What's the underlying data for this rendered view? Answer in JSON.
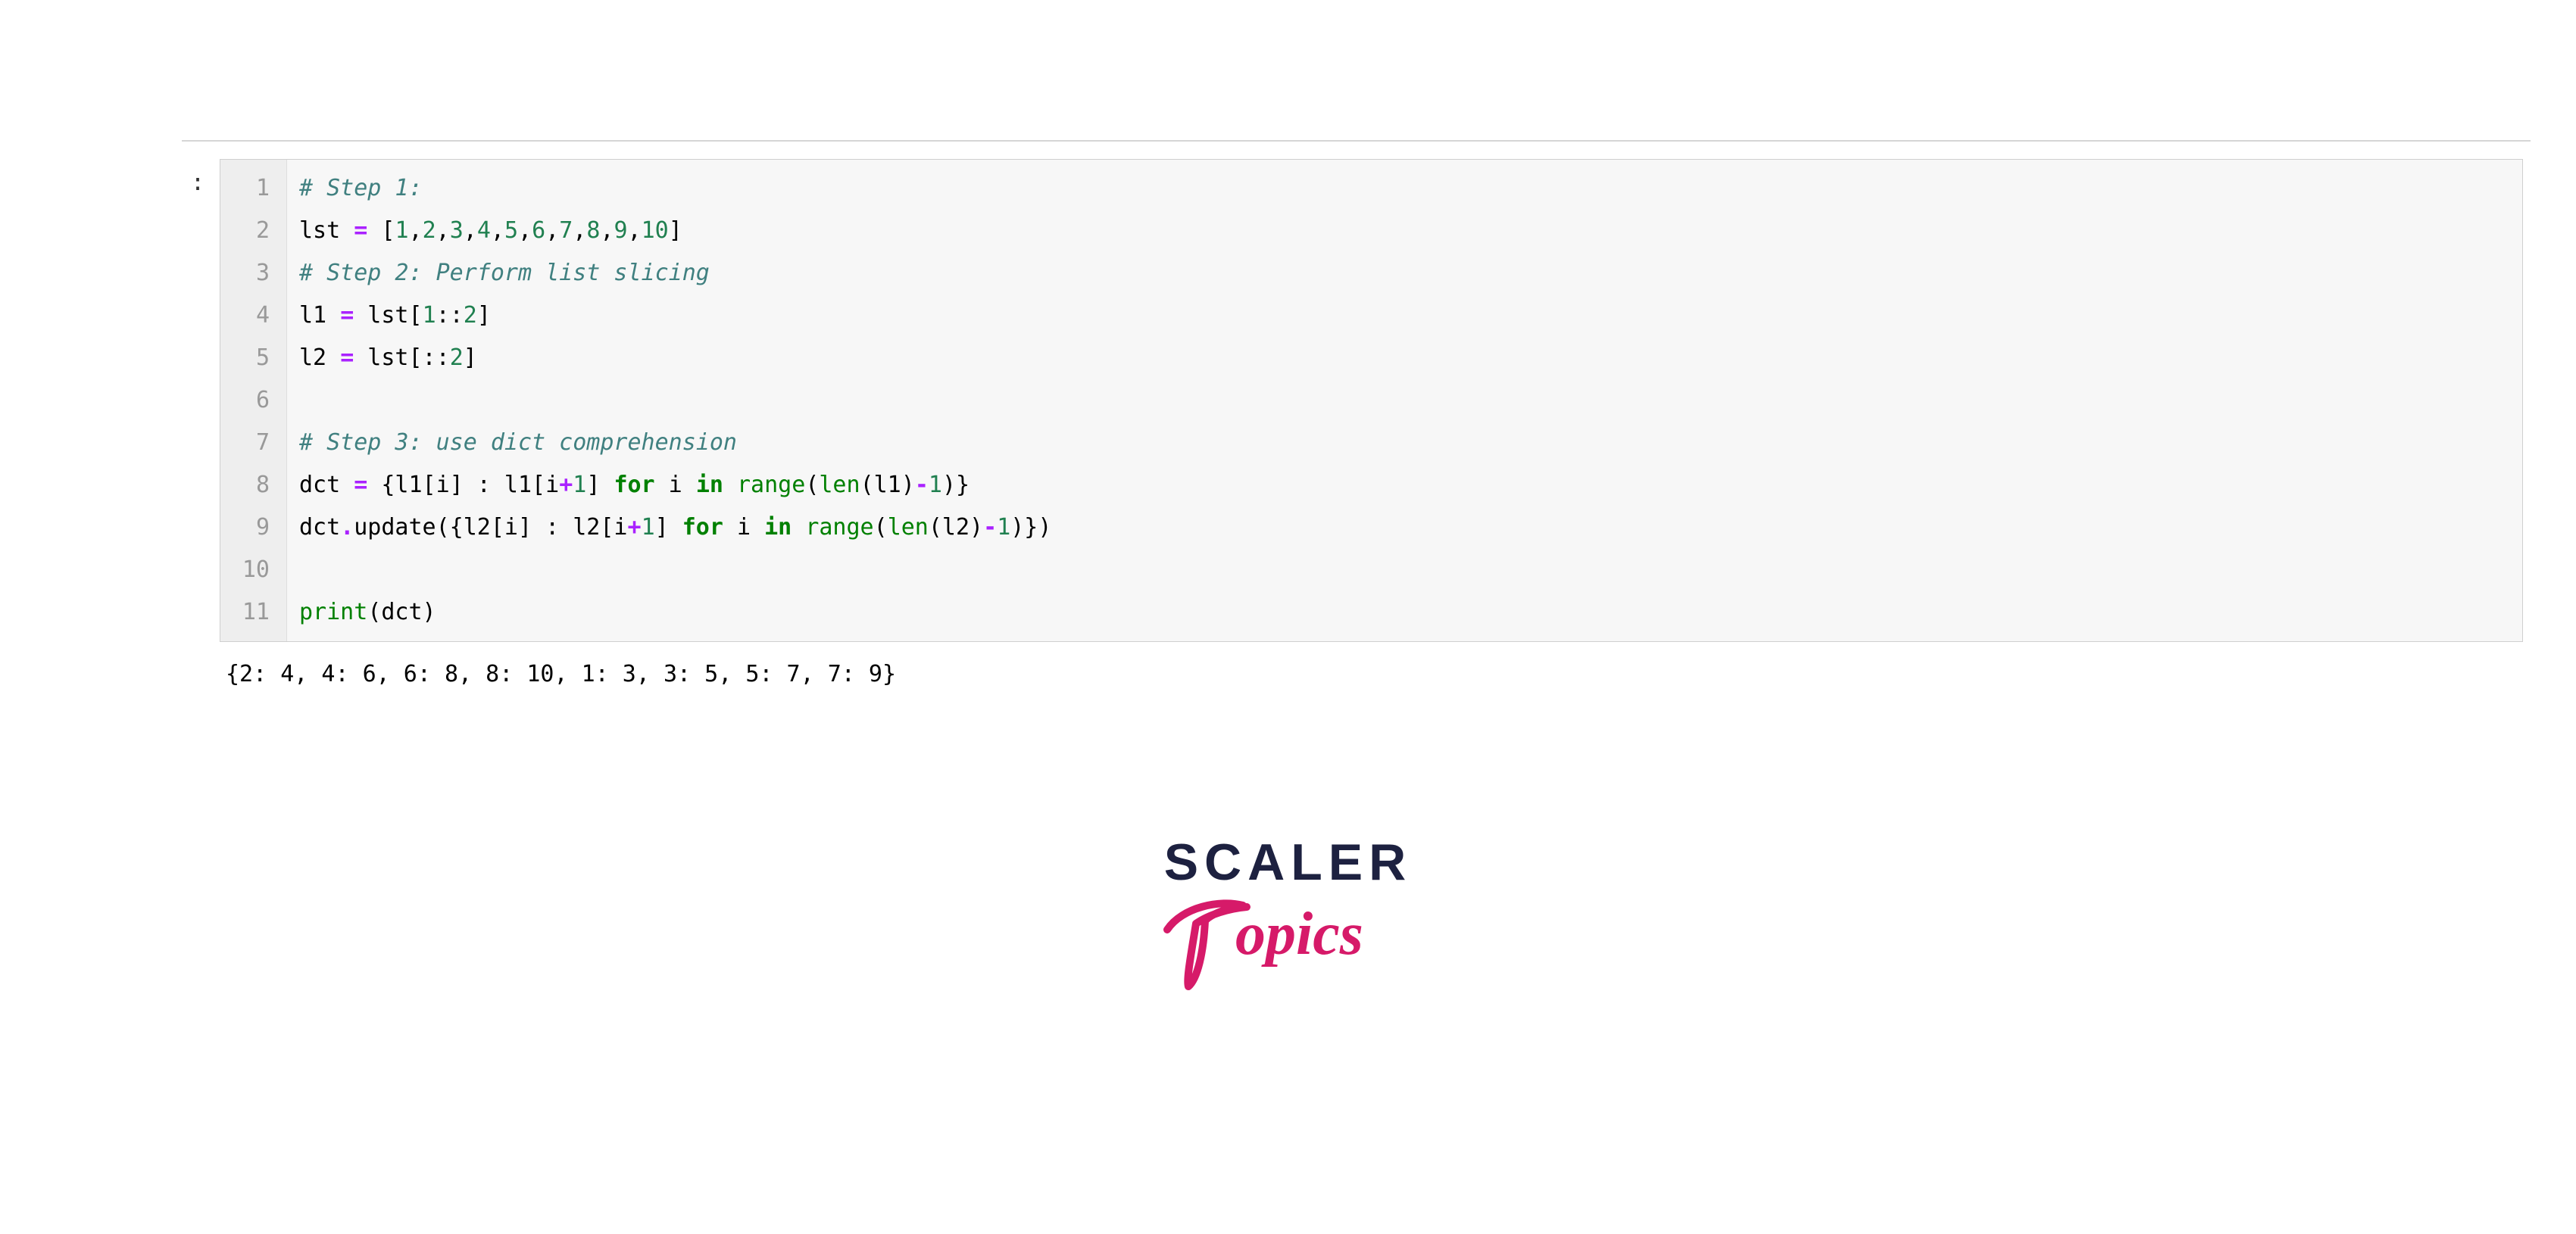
{
  "prompt": ":",
  "line_numbers": [
    "1",
    "2",
    "3",
    "4",
    "5",
    "6",
    "7",
    "8",
    "9",
    "10",
    "11"
  ],
  "code": {
    "l1_comment": "# Step 1:",
    "l2_a": "lst ",
    "l2_op": "=",
    "l2_b": " [",
    "l2_n1": "1",
    "l2_c1": ",",
    "l2_n2": "2",
    "l2_c2": ",",
    "l2_n3": "3",
    "l2_c3": ",",
    "l2_n4": "4",
    "l2_c4": ",",
    "l2_n5": "5",
    "l2_c5": ",",
    "l2_n6": "6",
    "l2_c6": ",",
    "l2_n7": "7",
    "l2_c7": ",",
    "l2_n8": "8",
    "l2_c8": ",",
    "l2_n9": "9",
    "l2_c9": ",",
    "l2_n10": "10",
    "l2_end": "]",
    "l3_comment": "# Step 2: Perform list slicing",
    "l4_a": "l1 ",
    "l4_op": "=",
    "l4_b": " lst[",
    "l4_n": "1",
    "l4_c": "::",
    "l4_n2": "2",
    "l4_end": "]",
    "l5_a": "l2 ",
    "l5_op": "=",
    "l5_b": " lst[::",
    "l5_n": "2",
    "l5_end": "]",
    "l6_blank": "",
    "l7_comment": "# Step 3: use dict comprehension",
    "l8_a": "dct ",
    "l8_op": "=",
    "l8_b": " {l1[i] : l1[i",
    "l8_plus": "+",
    "l8_n1": "1",
    "l8_c": "] ",
    "l8_for": "for",
    "l8_d": " i ",
    "l8_in": "in",
    "l8_e": " ",
    "l8_range": "range",
    "l8_f": "(",
    "l8_len": "len",
    "l8_g": "(l1)",
    "l8_minus": "-",
    "l8_n2": "1",
    "l8_h": ")}",
    "l9_a": "dct",
    "l9_dot": ".",
    "l9_upd": "update",
    "l9_b": "({l2[i] : l2[i",
    "l9_plus": "+",
    "l9_n1": "1",
    "l9_c": "] ",
    "l9_for": "for",
    "l9_d": " i ",
    "l9_in": "in",
    "l9_e": " ",
    "l9_range": "range",
    "l9_f": "(",
    "l9_len": "len",
    "l9_g": "(l2)",
    "l9_minus": "-",
    "l9_n2": "1",
    "l9_h": ")})",
    "l10_blank": "",
    "l11_print": "print",
    "l11_b": "(dct)"
  },
  "output": "{2: 4, 4: 6, 6: 8, 8: 10, 1: 3, 3: 5, 5: 7, 7: 9}",
  "logo": {
    "scaler": "SCALER",
    "topics": "Topics"
  }
}
